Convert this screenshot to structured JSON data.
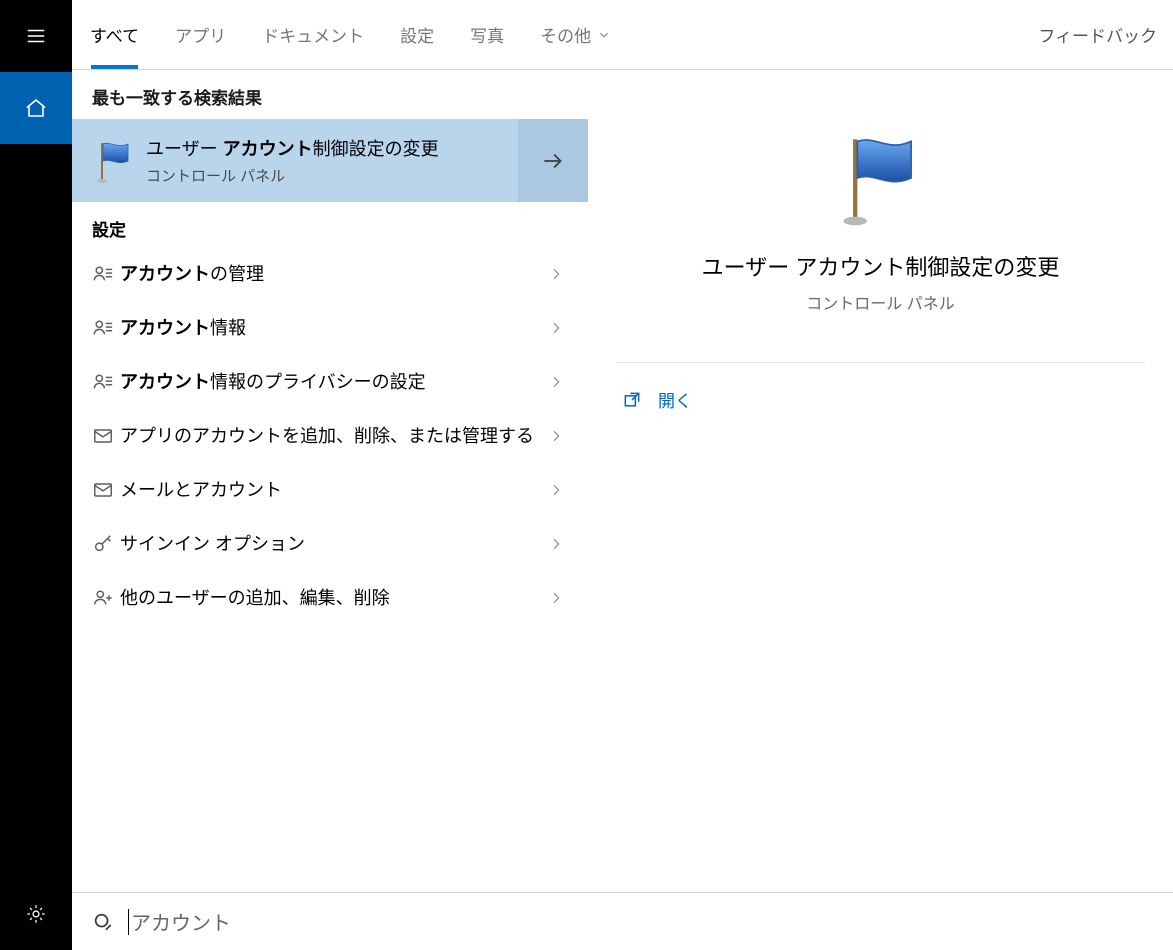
{
  "rail": {
    "menu": "menu",
    "home": "home",
    "settings": "settings"
  },
  "tabs": {
    "items": [
      "すべて",
      "アプリ",
      "ドキュメント",
      "設定",
      "写真",
      "その他"
    ],
    "active_index": 0,
    "feedback": "フィードバック"
  },
  "results": {
    "best_match_heading": "最も一致する検索結果",
    "best_match": {
      "title_prefix": "ユーザー ",
      "title_bold": "アカウント",
      "title_suffix": "制御設定の変更",
      "subtitle": "コントロール パネル"
    },
    "settings_heading": "設定",
    "items": [
      {
        "icon": "user-list",
        "bold": "アカウント",
        "suffix": "の管理"
      },
      {
        "icon": "user-list",
        "bold": "アカウント",
        "suffix": "情報"
      },
      {
        "icon": "user-list",
        "bold": "アカウント",
        "suffix": "情報のプライバシーの設定"
      },
      {
        "icon": "mail",
        "bold": "",
        "suffix": "アプリのアカウントを追加、削除、または管理する"
      },
      {
        "icon": "mail",
        "bold": "",
        "suffix": "メールとアカウント"
      },
      {
        "icon": "key",
        "bold": "",
        "suffix": "サインイン オプション"
      },
      {
        "icon": "user-add",
        "bold": "",
        "suffix": "他のユーザーの追加、編集、削除"
      }
    ]
  },
  "detail": {
    "title": "ユーザー アカウント制御設定の変更",
    "subtitle": "コントロール パネル",
    "open_label": "開く"
  },
  "search": {
    "value": "アカウント"
  }
}
